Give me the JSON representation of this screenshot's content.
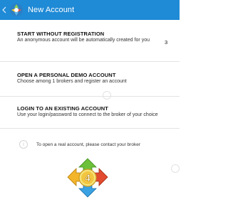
{
  "header": {
    "title": "New Account",
    "background": "#1f8ad6",
    "back_icon": "chevron-left-icon",
    "app_icon": "metatrader-icon"
  },
  "options": [
    {
      "title": "START WITHOUT REGISTRATION",
      "description": "An anonymous account will be automatically created for you",
      "badge": "3"
    },
    {
      "title": "OPEN A PERSONAL DEMO ACCOUNT",
      "description": "Choose among 1 brokers and register an account"
    },
    {
      "title": "LOGIN TO AN EXISTING ACCOUNT",
      "description": "Use your login/password to connect to the broker of your choice"
    }
  ],
  "info": {
    "icon": "info-circle-icon",
    "text": "To open a real account, please contact your broker"
  },
  "logo": {
    "icon": "metatrader-4-logo",
    "number": "4"
  }
}
